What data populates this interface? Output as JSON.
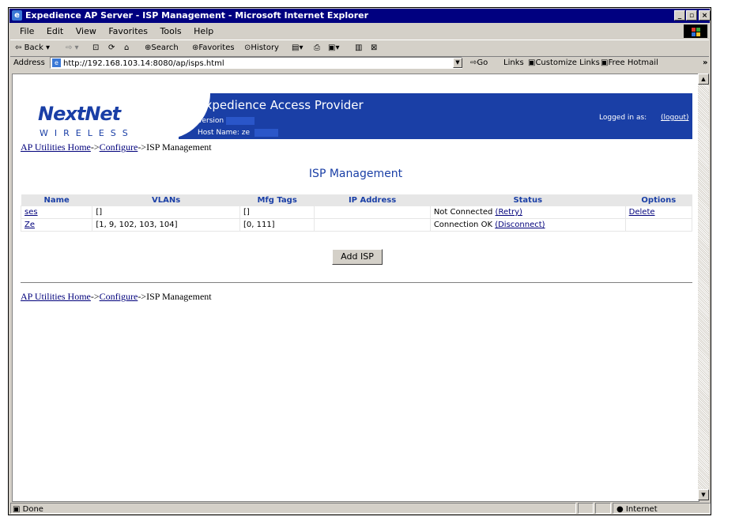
{
  "window": {
    "title": "Expedience AP Server - ISP Management - Microsoft Internet Explorer"
  },
  "menu": [
    "File",
    "Edit",
    "View",
    "Favorites",
    "Tools",
    "Help"
  ],
  "toolbar": {
    "back": "Back",
    "search": "Search",
    "favorites": "Favorites",
    "history": "History"
  },
  "address": {
    "label": "Address",
    "url": "http://192.168.103.14:8080/ap/isps.html",
    "go": "Go",
    "links": "Links",
    "link1": "Customize Links",
    "link2": "Free Hotmail"
  },
  "banner": {
    "logo_main": "NextNet",
    "logo_sub": "WIRELESS",
    "title": "Expedience Access Provider",
    "version_label": "Version",
    "host_label": "Host Name: ze",
    "logged_in": "Logged in as:",
    "logout": "(logout)"
  },
  "breadcrumb": {
    "home": "AP Utilities Home",
    "sep1": "->",
    "configure": "Configure",
    "current": "->ISP Management"
  },
  "page": {
    "heading": "ISP Management",
    "add_button": "Add ISP"
  },
  "table": {
    "headers": [
      "Name",
      "VLANs",
      "Mfg Tags",
      "IP Address",
      "Status",
      "Options"
    ],
    "rows": [
      {
        "name": "ses",
        "vlans": "[]",
        "tags": "[]",
        "ip": "",
        "status": "Not Connected",
        "status_link": "(Retry)",
        "option": "Delete"
      },
      {
        "name": "Ze",
        "vlans": "[1, 9, 102, 103, 104]",
        "tags": "[0, 111]",
        "ip": "",
        "status": "Connection OK",
        "status_link": "(Disconnect)",
        "option": ""
      }
    ]
  },
  "status": {
    "left": "Done",
    "zone": "Internet"
  },
  "colors": {
    "banner": "#1a3fa6",
    "titlebar": "#000080"
  }
}
